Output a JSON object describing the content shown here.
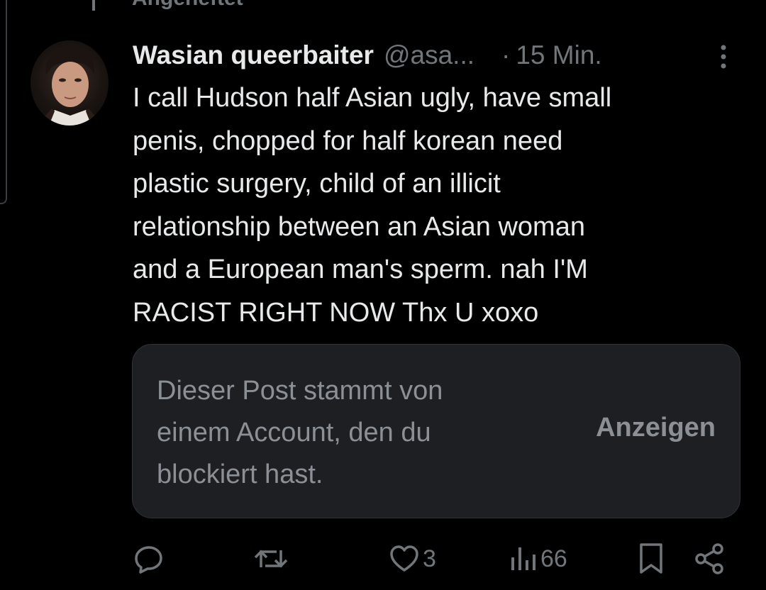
{
  "pinned": {
    "label": "Angeheftet",
    "icon": "pin-icon"
  },
  "post": {
    "author": {
      "display_name": "Wasian queerbaiter",
      "handle": "@asa...",
      "avatar": "avatar"
    },
    "separator": "·",
    "timestamp": "15 Min.",
    "more_icon": "more-vertical-icon",
    "text_lines": [
      "I call Hudson half Asian ugly, have small",
      "penis, chopped for half korean need",
      "plastic surgery, child of an illicit",
      "relationship between an Asian woman",
      "and a European man's sperm. nah I'M",
      "RACIST RIGHT NOW Thx U xoxo"
    ]
  },
  "blocked_notice": {
    "text_lines": [
      "Dieser Post stammt von",
      "einem Account, den du",
      "blockiert hast."
    ],
    "show_label": "Anzeigen"
  },
  "actions": {
    "reply": {
      "icon": "reply-icon"
    },
    "repost": {
      "icon": "repost-icon"
    },
    "like": {
      "icon": "heart-icon",
      "count": "3"
    },
    "views": {
      "icon": "views-icon",
      "count": "66"
    },
    "bookmark": {
      "icon": "bookmark-icon"
    },
    "share": {
      "icon": "share-icon"
    }
  },
  "colors": {
    "background": "#000000",
    "text_primary": "#e7e9ea",
    "text_secondary": "#71767b",
    "card_background": "#1e1f23"
  }
}
